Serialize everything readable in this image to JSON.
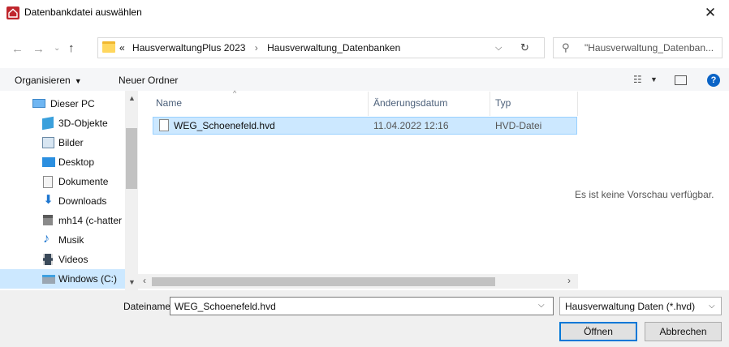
{
  "window": {
    "title": "Datenbankdatei auswählen",
    "close_label": "✕"
  },
  "navigation": {
    "address_prefix": "«",
    "breadcrumb": [
      "HausverwaltungPlus 2023",
      "Hausverwaltung_Datenbanken"
    ],
    "breadcrumb_separator": "›",
    "search_placeholder": "\"Hausverwaltung_Datenban..."
  },
  "toolbar": {
    "organize_label": "Organisieren",
    "new_folder_label": "Neuer Ordner",
    "help_label": "?"
  },
  "sidebar": {
    "items": [
      {
        "label": "Dieser PC",
        "icon": "computer-icon"
      },
      {
        "label": "3D-Objekte",
        "icon": "3d-objects-icon"
      },
      {
        "label": "Bilder",
        "icon": "pictures-icon"
      },
      {
        "label": "Desktop",
        "icon": "desktop-icon"
      },
      {
        "label": "Dokumente",
        "icon": "documents-icon"
      },
      {
        "label": "Downloads",
        "icon": "downloads-icon"
      },
      {
        "label": "mh14 (c-hatter",
        "icon": "network-drive-icon"
      },
      {
        "label": "Musik",
        "icon": "music-icon"
      },
      {
        "label": "Videos",
        "icon": "videos-icon"
      },
      {
        "label": "Windows (C:)",
        "icon": "drive-icon"
      }
    ],
    "selected_index": 9
  },
  "file_list": {
    "columns": [
      "Name",
      "Änderungsdatum",
      "Typ"
    ],
    "rows": [
      {
        "name": "WEG_Schoenefeld.hvd",
        "date": "11.04.2022 12:16",
        "type": "HVD-Datei",
        "selected": true
      }
    ]
  },
  "preview": {
    "message": "Es ist keine Vorschau verfügbar."
  },
  "footer": {
    "filename_label": "Dateiname:",
    "filename_value": "WEG_Schoenefeld.hvd",
    "filetype_value": "Hausverwaltung Daten (*.hvd)",
    "open_label": "Öffnen",
    "cancel_label": "Abbrechen"
  },
  "colors": {
    "accent": "#0078d7",
    "selection": "#cce8ff",
    "app_icon": "#c0262d"
  }
}
